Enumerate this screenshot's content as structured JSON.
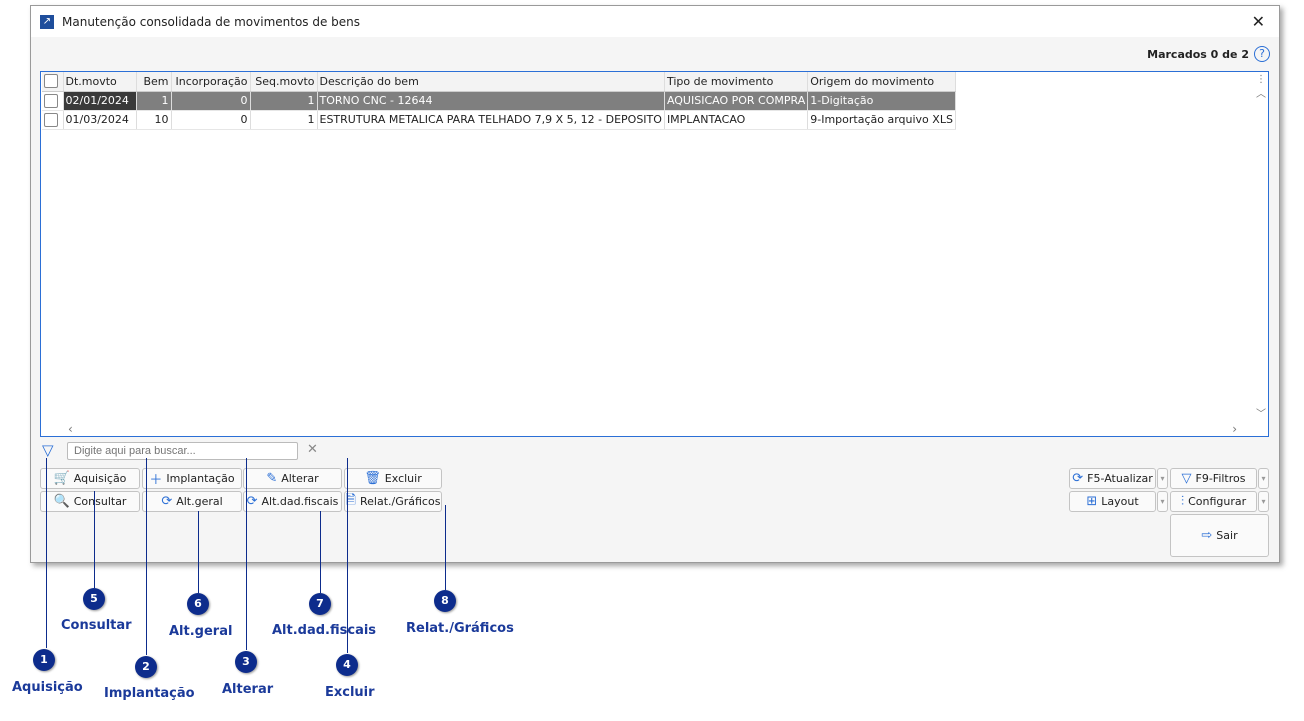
{
  "window": {
    "title": "Manutenção consolidada de movimentos de bens",
    "marked": "Marcados 0 de 2"
  },
  "grid": {
    "columns": [
      "Dt.movto",
      "Bem",
      "Incorporação",
      "Seq.movto",
      "Descrição do bem",
      "Tipo de movimento",
      "Origem do movimento"
    ],
    "rows": [
      [
        "02/01/2024",
        "1",
        "0",
        "1",
        "TORNO CNC - 12644",
        "AQUISICAO POR COMPRA",
        "1-Digitação"
      ],
      [
        "01/03/2024",
        "10",
        "0",
        "1",
        "ESTRUTURA METALICA PARA TELHADO 7,9 X 5, 12 - DEPOSITO",
        "IMPLANTACAO",
        "9-Importação arquivo XLS"
      ]
    ]
  },
  "search": {
    "placeholder": "Digite aqui para buscar..."
  },
  "buttons": {
    "aquisicao": "Aquisição",
    "implantacao": "Implantação",
    "alterar": "Alterar",
    "excluir": "Excluir",
    "consultar": "Consultar",
    "alt_geral": "Alt.geral",
    "alt_dad_fiscais": "Alt.dad.fiscais",
    "relat": "Relat./Gráficos",
    "f5": "F5-Atualizar",
    "f9": "F9-Filtros",
    "layout": "Layout",
    "configurar": "Configurar",
    "sair": "Sair"
  },
  "annotations": [
    {
      "n": "1",
      "label": "Aquisição"
    },
    {
      "n": "2",
      "label": "Implantação"
    },
    {
      "n": "3",
      "label": "Alterar"
    },
    {
      "n": "4",
      "label": "Excluir"
    },
    {
      "n": "5",
      "label": "Consultar"
    },
    {
      "n": "6",
      "label": "Alt.geral"
    },
    {
      "n": "7",
      "label": "Alt.dad.fiscais"
    },
    {
      "n": "8",
      "label": "Relat./Gráficos"
    }
  ]
}
